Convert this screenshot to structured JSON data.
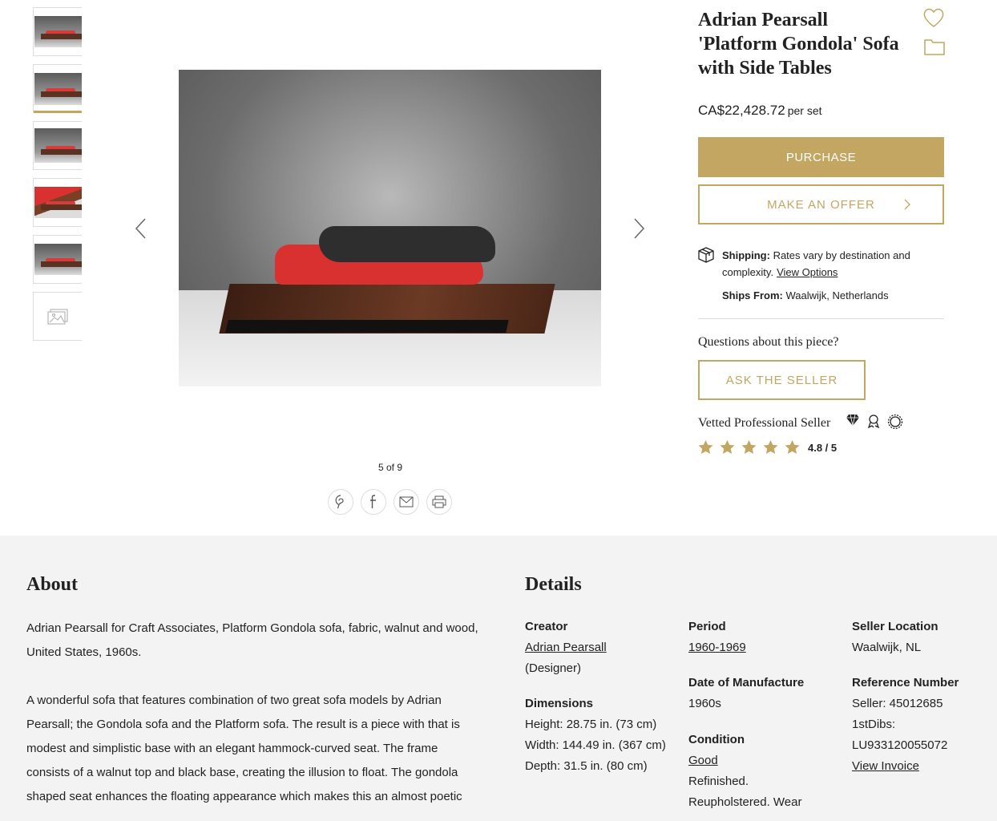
{
  "gallery": {
    "counter": "5 of 9",
    "thumbnails": [
      "thumb-1",
      "thumb-2",
      "thumb-3",
      "thumb-4",
      "thumb-5"
    ],
    "more_icon": "gallery-icon"
  },
  "product": {
    "title": "Adrian Pearsall 'Platform Gondola' Sofa with Side Tables",
    "price": "CA$22,428.72",
    "price_unit": "per set",
    "purchase_label": "PURCHASE",
    "offer_label": "MAKE AN OFFER"
  },
  "shipping": {
    "label": "Shipping:",
    "text": "Rates vary by destination and complexity.",
    "link": "View Options",
    "from_label": "Ships From:",
    "from_value": "Waalwijk, Netherlands"
  },
  "seller": {
    "questions": "Questions about this piece?",
    "ask_label": "ASK THE SELLER",
    "vetted": "Vetted Professional Seller",
    "rating": "4.8 / 5",
    "stars": 5
  },
  "about": {
    "heading": "About",
    "p1": "Adrian Pearsall for Craft Associates, Platform Gondola sofa, fabric, walnut and wood, United States, 1960s.",
    "p2": "A wonderful sofa that features combination of two great sofa models by Adrian Pearsall; the Gondola sofa and the Platform sofa. The result is a piece with that is modest and simplistic base with an elegant hammock-curved seat. The frame consists of a walnut top and black base, creating the illusion to float. The gondola shaped seat enhances the floating appearance which makes this an almost poetic"
  },
  "details": {
    "heading": "Details",
    "creator_label": "Creator",
    "creator_link": "Adrian Pearsall",
    "creator_role": "(Designer)",
    "dimensions_label": "Dimensions",
    "height": "Height: 28.75 in. (73 cm)",
    "width": "Width: 144.49 in. (367 cm)",
    "depth": "Depth: 31.5 in. (80 cm)",
    "period_label": "Period",
    "period_link": "1960-1969",
    "dom_label": "Date of Manufacture",
    "dom_value": "1960s",
    "condition_label": "Condition",
    "condition_link": "Good",
    "condition_text": "Refinished. Reupholstered. Wear",
    "location_label": "Seller Location",
    "location_value": "Waalwijk, NL",
    "ref_label": "Reference Number",
    "ref_seller": "Seller: 45012685",
    "ref_1stdibs_label": "1stDibs:",
    "ref_1stdibs": "LU933120055072",
    "invoice_link": "View Invoice"
  },
  "colors": {
    "accent": "#c2a661",
    "section_bg": "#f3f3f3"
  }
}
